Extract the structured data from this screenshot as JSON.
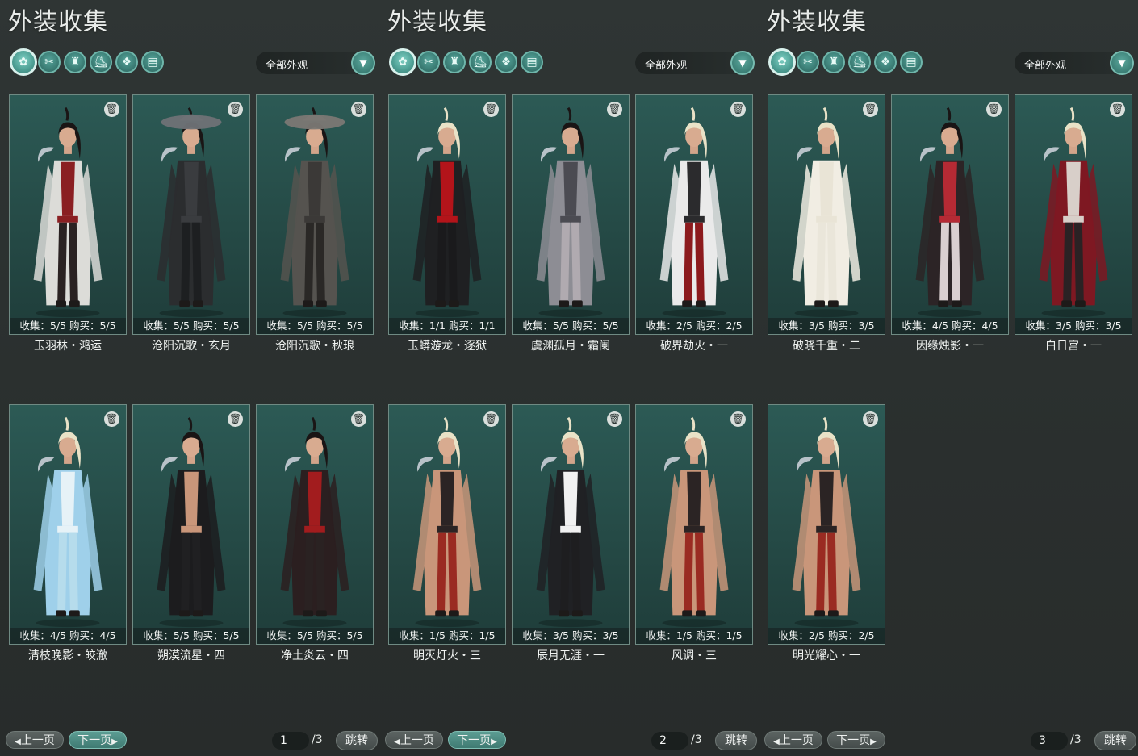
{
  "panels": [
    {
      "title": "外装收集",
      "filter": "全部外观",
      "cards": [
        {
          "stats": "收集：5/5  购买：5/5",
          "name": "玉羽林・鸿运",
          "outfit": "white-red"
        },
        {
          "stats": "收集：5/5  购买：5/5",
          "name": "沧阳沉歌・玄月",
          "outfit": "black-hat"
        },
        {
          "stats": "收集：5/5  购买：5/5",
          "name": "沧阳沉歌・秋琅",
          "outfit": "grey-hat"
        },
        {
          "stats": "收集：4/5  购买：4/5",
          "name": "清枝晚影・皎澈",
          "outfit": "blue"
        },
        {
          "stats": "收集：5/5  购买：5/5",
          "name": "朔漠流星・四",
          "outfit": "black-bare"
        },
        {
          "stats": "收集：5/5  购买：5/5",
          "name": "净土炎云・四",
          "outfit": "black-red"
        }
      ],
      "pager": {
        "prev": "上一页",
        "next": "下一页",
        "page": "1",
        "total": "/3",
        "jump": "跳转"
      }
    },
    {
      "title": "外装收集",
      "filter": "全部外观",
      "cards": [
        {
          "stats": "收集：1/1  购买：1/1",
          "name": "玉蟒游龙・逐狱",
          "outfit": "black-scarf"
        },
        {
          "stats": "收集：5/5  购买：5/5",
          "name": "虞渊孤月・霜阑",
          "outfit": "grey-blood"
        },
        {
          "stats": "收集：2/5  购买：2/5",
          "name": "破界劫火・一",
          "outfit": "black-white-red"
        },
        {
          "stats": "收集：1/5  购买：1/5",
          "name": "明灭灯火・三",
          "outfit": "bare-red"
        },
        {
          "stats": "收集：3/5  购买：3/5",
          "name": "辰月无涯・一",
          "outfit": "black-white"
        },
        {
          "stats": "收集：1/5  购买：1/5",
          "name": "风调・三",
          "outfit": "bare-red"
        }
      ],
      "pager": {
        "prev": "上一页",
        "next": "下一页",
        "page": "2",
        "total": "/3",
        "jump": "跳转"
      }
    },
    {
      "title": "外装收集",
      "filter": "全部外观",
      "cards": [
        {
          "stats": "收集：3/5  购买：3/5",
          "name": "破晓千重・二",
          "outfit": "white"
        },
        {
          "stats": "收集：4/5  购买：4/5",
          "name": "因缘烛影・一",
          "outfit": "red-white"
        },
        {
          "stats": "收集：3/5  购买：3/5",
          "name": "白日宫・一",
          "outfit": "red-cape"
        },
        {
          "stats": "收集：2/5  购买：2/5",
          "name": "明光耀心・一",
          "outfit": "bare-red"
        }
      ],
      "pager": {
        "prev": "上一页",
        "next": "下一页",
        "page": "3",
        "total": "/3",
        "jump": "跳转"
      }
    }
  ],
  "category_icons": [
    "outfit-icon",
    "hair-icon",
    "top-icon",
    "shoes-icon",
    "accessory-icon",
    "pants-icon"
  ],
  "colors": {
    "accent": "#4c9d92",
    "card_bg": "#27504b",
    "panel_bg": "#2c3231"
  }
}
